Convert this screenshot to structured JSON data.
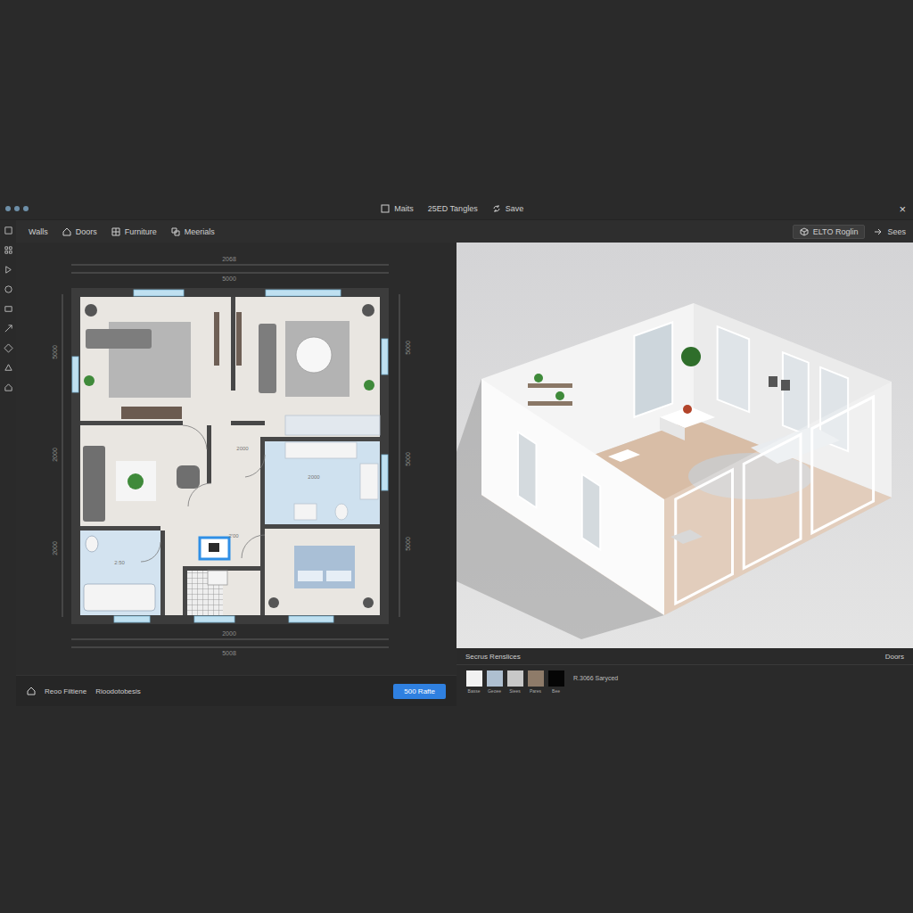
{
  "window": {
    "menu": [
      "Maits",
      "25ED Tangles",
      "Save"
    ],
    "close": "×"
  },
  "toolbar": {
    "items": [
      "Walls",
      "Doors",
      "Furniture",
      "Meerials"
    ],
    "view_button": "ELTO Roglin",
    "share": "Sees"
  },
  "plan": {
    "dimensions": {
      "top": [
        "2068",
        "5000"
      ],
      "bottom": [
        "2000",
        "5008"
      ],
      "left": [
        "5000",
        "2000",
        "2000"
      ],
      "right": [
        "5000",
        "5000",
        "5000"
      ]
    },
    "room_labels": [
      "2:50",
      "2000",
      "2000"
    ],
    "marker": {
      "label": "2'00",
      "selected": true
    }
  },
  "footer": {
    "items": [
      "Reoo Filtiene",
      "Rioodotobesis"
    ],
    "button": "500 Rafte"
  },
  "materials": {
    "title": "Secrus Renslices",
    "action": "Doors",
    "swatches": [
      {
        "label": "Basse",
        "color": "#f2f2f2"
      },
      {
        "label": "Geoee",
        "color": "#aebfd0"
      },
      {
        "label": "Siees",
        "color": "#c8c8c8"
      },
      {
        "label": "Pares",
        "color": "#8e7b69"
      },
      {
        "label": "Bee",
        "color": "#050505"
      }
    ],
    "note": "R.3066 Saryced"
  }
}
